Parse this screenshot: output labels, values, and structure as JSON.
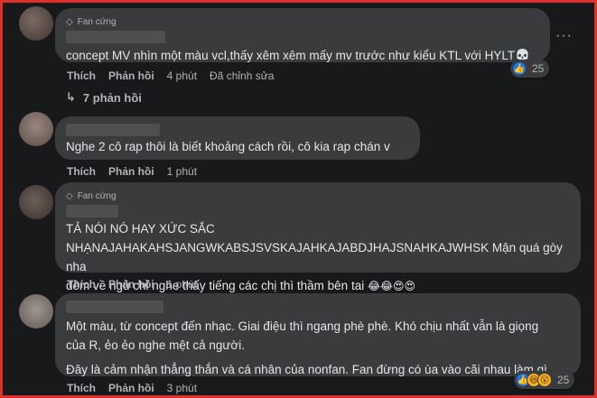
{
  "comments": [
    {
      "badge": "Fan cứng",
      "text": "concept MV nhìn một màu vcl,thấy xêm xêm mấy mv trước như kiểu KTL với HYLT💀",
      "like_label": "Thích",
      "reply_label": "Phản hồi",
      "time": "4 phút",
      "edited": "Đã chỉnh sửa",
      "reaction_count": "25",
      "replies_label": "7 phản hồi"
    },
    {
      "text": "Nghe 2 cô rap thôi là biết khoảng cách rồi, cô kia rap chán v",
      "like_label": "Thích",
      "reply_label": "Phản hồi",
      "time": "1 phút"
    },
    {
      "badge": "Fan cứng",
      "text_line1": "TẢ NÓI NÓ HAY XỨC SẮC",
      "text_line2": "NHẠNAJAHAKAHSJANGWKABSJSVSKAJAHKAJABDJHAJSNAHKAJWHSK Mận quá gòy nha",
      "text_line3": "đêm về ngủ chỉ nghe thấy tiếng các chị thì thầm bên tai",
      "emojis": "😂😂😍😍",
      "like_label": "Thích",
      "reply_label": "Phản hồi",
      "time": "1 phút"
    },
    {
      "text_line1": "Một màu, từ concept đến nhạc. Giai điệu thì ngang phè phè. Khó chịu nhất vẫn là giọng",
      "text_line2": "của R, ẻo ẻo nghe mệt cả người.",
      "text_line3": "Đây là cảm nhận thẳng thắn và cá nhân của nonfan. Fan đừng có ùa vào cãi nhau làm gì.",
      "like_label": "Thích",
      "reply_label": "Phản hồi",
      "time": "3 phút",
      "reaction_count": "25"
    }
  ],
  "icons": {
    "more": "more-dots-icon",
    "badge": "diamond-icon",
    "reply_arrow": "reply-arrow-icon",
    "like": "like-icon",
    "haha": "haha-icon",
    "wow": "wow-icon"
  },
  "colors": {
    "background": "#18191a",
    "bubble": "#3a3b3c",
    "text": "#e4e6eb",
    "muted": "#b0b3b8",
    "like_blue": "#1877f2",
    "frame_red": "#e0302a"
  }
}
